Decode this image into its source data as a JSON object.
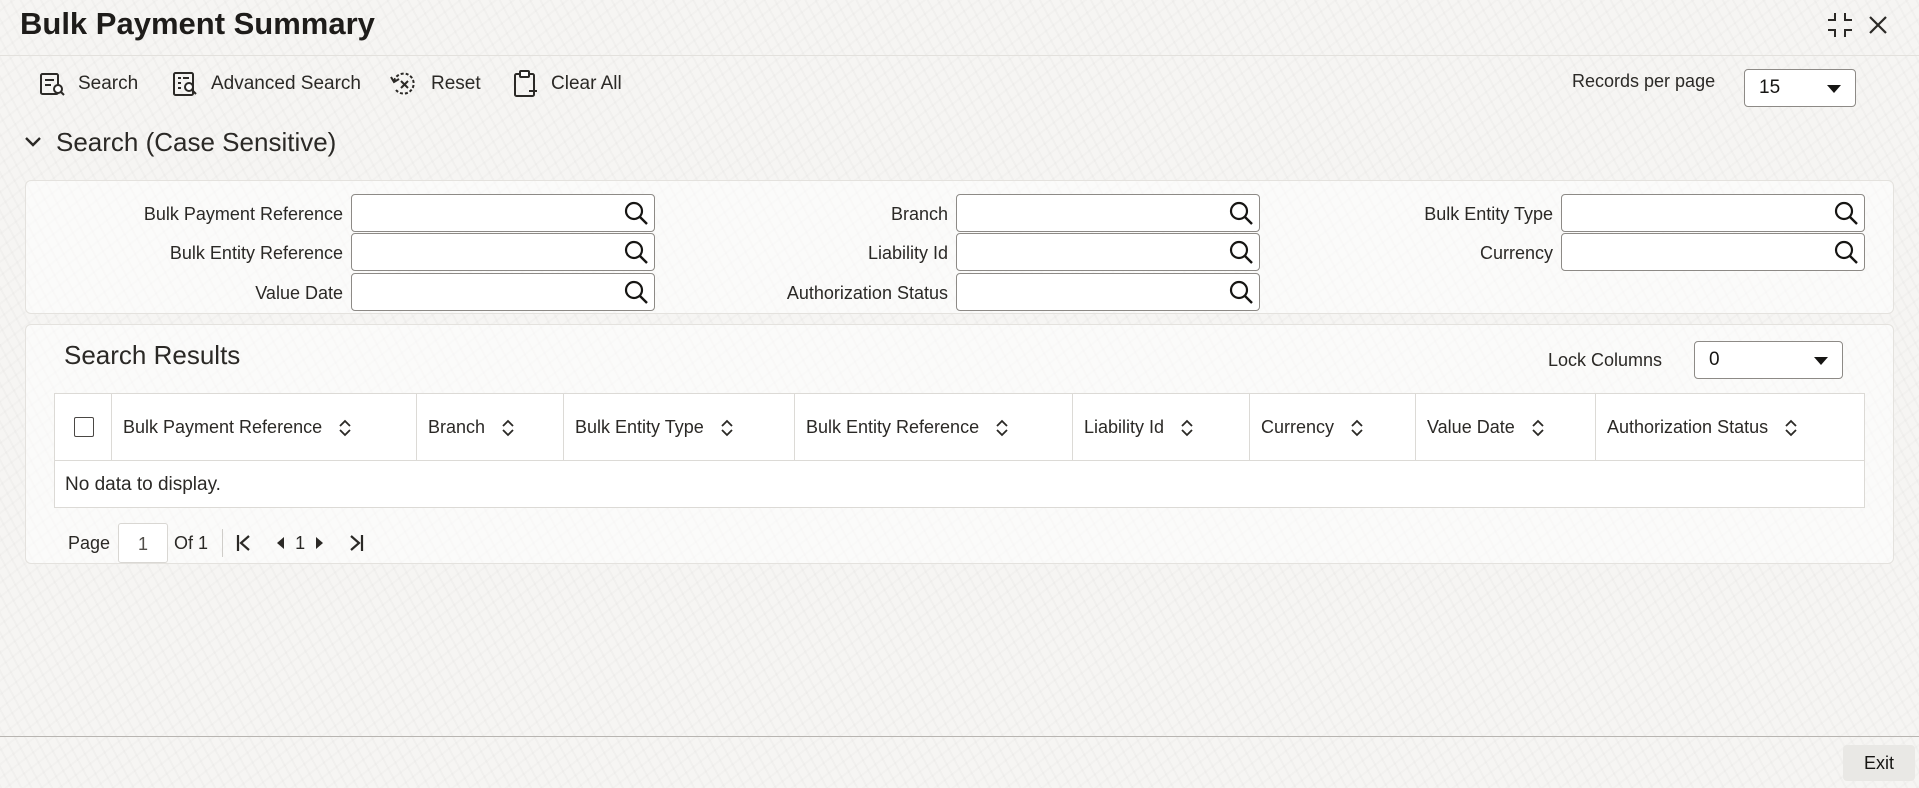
{
  "window": {
    "title": "Bulk Payment Summary",
    "controls": [
      {
        "name": "minimize-restore-icon"
      },
      {
        "name": "close-icon"
      }
    ]
  },
  "toolbar": {
    "search_label": "Search",
    "advanced_search_label": "Advanced Search",
    "reset_label": "Reset",
    "clear_all_label": "Clear All",
    "records_per_page_label": "Records per page",
    "records_per_page_value": "15"
  },
  "search_section": {
    "title": "Search (Case Sensitive)",
    "expanded": true,
    "fields": {
      "bulk_payment_reference": {
        "label": "Bulk Payment Reference",
        "value": ""
      },
      "branch": {
        "label": "Branch",
        "value": ""
      },
      "bulk_entity_type": {
        "label": "Bulk Entity Type",
        "value": ""
      },
      "bulk_entity_reference": {
        "label": "Bulk Entity Reference",
        "value": ""
      },
      "liability_id": {
        "label": "Liability Id",
        "value": ""
      },
      "currency": {
        "label": "Currency",
        "value": ""
      },
      "value_date": {
        "label": "Value Date",
        "value": ""
      },
      "authorization_status": {
        "label": "Authorization Status",
        "value": ""
      }
    }
  },
  "results": {
    "title": "Search Results",
    "lock_columns_label": "Lock Columns",
    "lock_columns_value": "0",
    "columns": [
      "Bulk Payment Reference",
      "Branch",
      "Bulk Entity Type",
      "Bulk Entity Reference",
      "Liability Id",
      "Currency",
      "Value Date",
      "Authorization Status"
    ],
    "rows": [],
    "empty_message": "No data to display."
  },
  "pagination": {
    "page_label": "Page",
    "current_page": "1",
    "of_label": "Of 1",
    "page_number": "1"
  },
  "footer": {
    "exit_label": "Exit"
  },
  "colors": {
    "background": "#f6f5f3",
    "panel_border": "#e4e2de",
    "text": "#161513",
    "input_border": "#8d8a86"
  }
}
